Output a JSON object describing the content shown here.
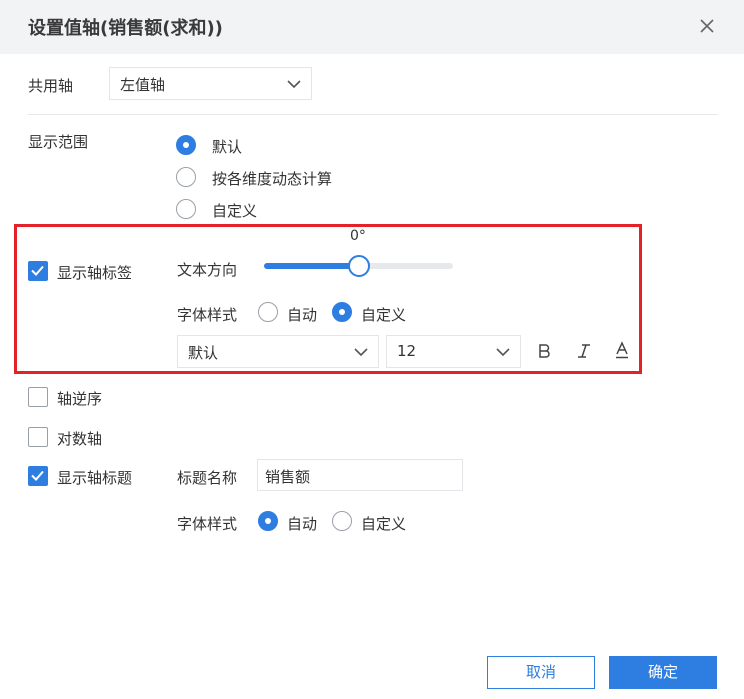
{
  "dialog": {
    "title": "设置值轴(销售额(求和))",
    "close_icon": "close-icon"
  },
  "shared_axis": {
    "label": "共用轴",
    "value": "左值轴"
  },
  "display_range": {
    "label": "显示范围",
    "options": [
      "默认",
      "按各维度动态计算",
      "自定义"
    ],
    "selected": "默认"
  },
  "axis_label": {
    "checkbox_label": "显示轴标签",
    "checked": true,
    "text_direction": {
      "label": "文本方向",
      "value_text": "0°",
      "slider_fraction": 0.5
    },
    "font_style": {
      "label": "字体样式",
      "options": [
        "自动",
        "自定义"
      ],
      "selected": "自定义"
    },
    "font_family": "默认",
    "font_size": "12",
    "format_icons": [
      "bold-icon",
      "italic-icon",
      "underline-icon"
    ]
  },
  "reverse_axis": {
    "label": "轴逆序",
    "checked": false
  },
  "log_axis": {
    "label": "对数轴",
    "checked": false
  },
  "axis_title": {
    "checkbox_label": "显示轴标题",
    "checked": true,
    "name_label": "标题名称",
    "name_value": "销售额",
    "font_style": {
      "label": "字体样式",
      "options": [
        "自动",
        "自定义"
      ],
      "selected": "自动"
    }
  },
  "footer": {
    "cancel": "取消",
    "confirm": "确定"
  },
  "colors": {
    "accent": "#2e7de1",
    "highlight_border": "#e5222a",
    "header_bg": "#f2f3f5"
  }
}
